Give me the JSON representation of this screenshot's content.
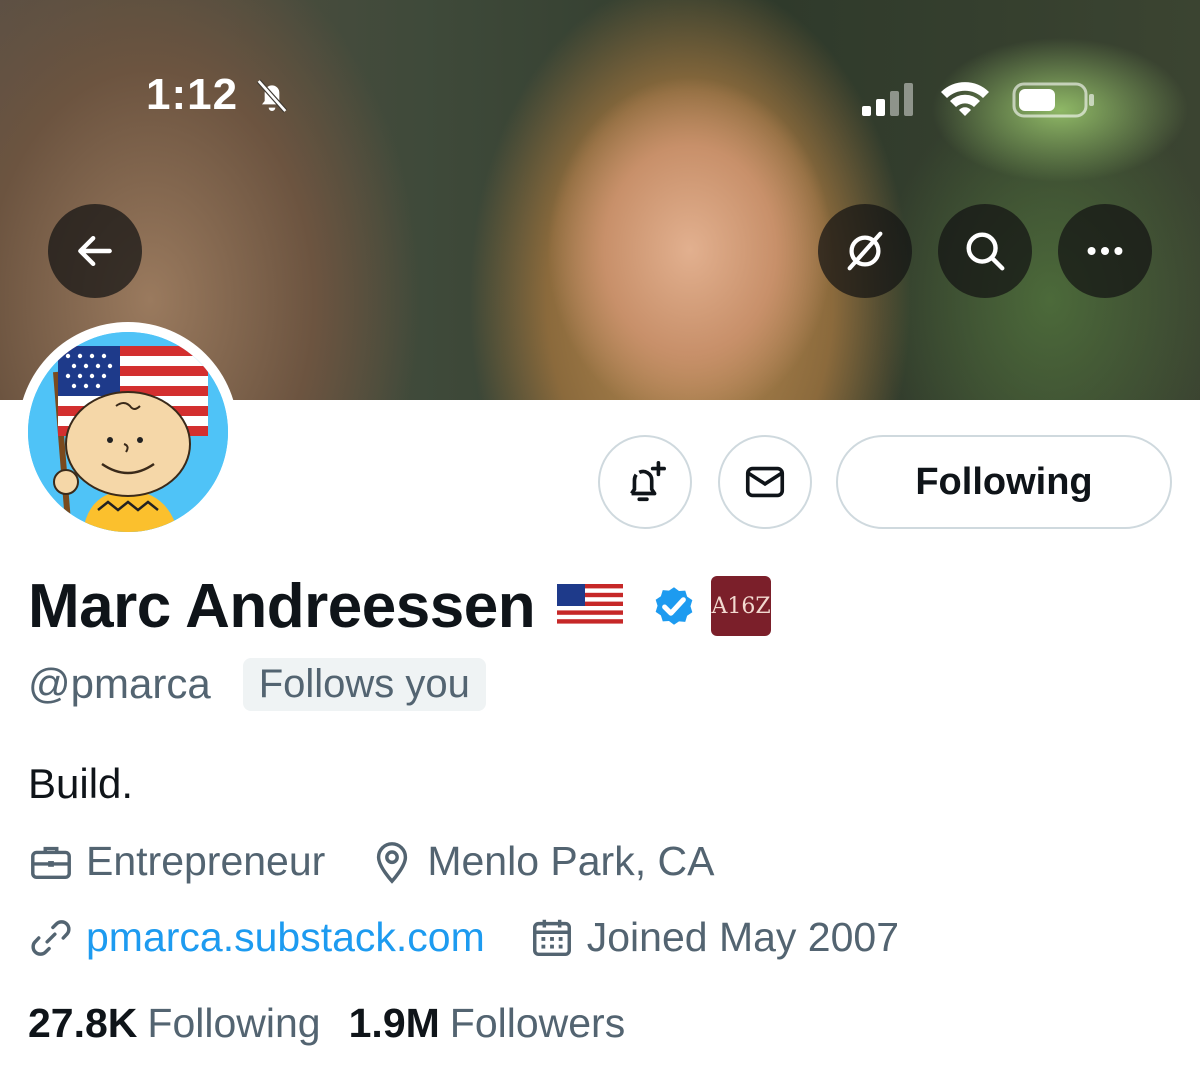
{
  "status_bar": {
    "time": "1:12",
    "icons": [
      "bell-slash-icon",
      "cellular-signal-icon",
      "wifi-icon",
      "battery-icon"
    ]
  },
  "header": {
    "buttons": [
      "back-arrow-icon",
      "grok-icon",
      "search-icon",
      "more-dots-icon"
    ]
  },
  "actions": {
    "notify_icon": "bell-plus-icon",
    "message_icon": "envelope-icon",
    "follow_label": "Following"
  },
  "profile": {
    "display_name": "Marc Andreessen",
    "name_emoji": "us-flag-emoji",
    "verified_badge": "verified-checkmark-icon",
    "affiliate_badge": "A16Z",
    "handle": "@pmarca",
    "follows_you": "Follows you",
    "bio": "Build.",
    "category": "Entrepreneur",
    "location": "Menlo Park, CA",
    "website": "pmarca.substack.com",
    "joined": "Joined May 2007"
  },
  "stats": {
    "following_count": "27.8K",
    "following_label": "Following",
    "followers_count": "1.9M",
    "followers_label": "Followers"
  },
  "colors": {
    "link": "#1d9bf0",
    "verified": "#1d9bf0",
    "secondary_text": "#536471",
    "primary_text": "#0f1419",
    "button_border": "#cfd9de",
    "affiliate_bg": "#7b1f2a"
  }
}
